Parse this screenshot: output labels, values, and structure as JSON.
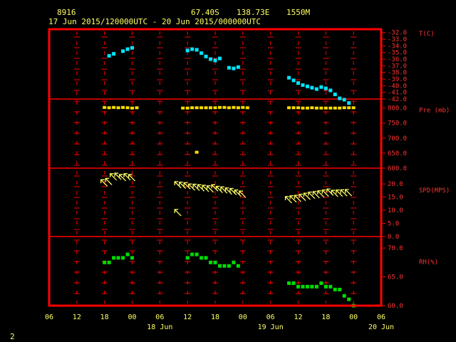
{
  "header": {
    "station": "8916",
    "lat": "67.40S",
    "lon": "138.73E",
    "elev": "1550M",
    "period": "17 Jun 2015/120000UTC - 20 Jun 2015/000000UTC"
  },
  "footer": {
    "page_number": "2"
  },
  "colors": {
    "frame": "#ff0000",
    "text": "#ffff66",
    "temp": "#00e5ff",
    "pres": "#ffdd00",
    "wind": "#ffff66",
    "rh": "#00dd00"
  },
  "chart_data": [
    {
      "type": "scatter",
      "name": "temperature",
      "ylabel": "T(C)",
      "ylim": [
        -42,
        -31.5
      ],
      "yticks": [
        "-32.0",
        "-33.0",
        "-34.0",
        "-35.0",
        "-36.0",
        "-37.0",
        "-38.0",
        "-39.0",
        "-40.0",
        "-41.0",
        "-42.0"
      ],
      "x_hours": [
        13,
        14,
        16,
        17,
        18,
        30,
        31,
        32,
        33,
        34,
        35,
        36,
        37,
        39,
        40,
        41,
        52,
        53,
        54,
        55,
        56,
        57,
        58,
        59,
        60,
        61,
        62,
        63,
        64,
        65
      ],
      "y": [
        -35.5,
        -35.2,
        -34.8,
        -34.5,
        -34.3,
        -34.7,
        -34.5,
        -34.6,
        -35.1,
        -35.6,
        -36.0,
        -36.2,
        -35.9,
        -37.3,
        -37.4,
        -37.2,
        -38.8,
        -39.2,
        -39.6,
        -39.9,
        -40.1,
        -40.3,
        -40.5,
        -40.2,
        -40.4,
        -40.7,
        -41.3,
        -41.9,
        -42.1,
        -42.6
      ],
      "x_hours_fixed": true
    },
    {
      "type": "scatter",
      "name": "pressure",
      "ylabel": "Pre (mb)",
      "ylim": [
        600,
        830
      ],
      "yticks": [
        "800.0",
        "750.0",
        "700.0",
        "650.0",
        "600.0"
      ],
      "x_hours": [
        12,
        13,
        14,
        15,
        16,
        17,
        18,
        19,
        29,
        30,
        31,
        32,
        33,
        34,
        35,
        36,
        37,
        38,
        39,
        40,
        41,
        42,
        43,
        52,
        53,
        54,
        55,
        56,
        57,
        58,
        59,
        60,
        61,
        62,
        63,
        64,
        65,
        66,
        32
      ],
      "y": [
        802,
        801,
        802,
        801,
        802,
        801,
        800,
        801,
        800,
        800,
        801,
        801,
        801,
        801,
        801,
        801,
        802,
        802,
        801,
        802,
        801,
        802,
        801,
        801,
        801,
        801,
        800,
        800,
        801,
        800,
        800,
        800,
        800,
        800,
        800,
        801,
        801,
        801,
        653
      ]
    },
    {
      "type": "wind_barbs",
      "name": "wind",
      "ylabel": "SPD(MPS)",
      "ylim": [
        0,
        26
      ],
      "yticks": [
        "20.0",
        "15.0",
        "10.0",
        "5.0",
        "0.0"
      ],
      "x_hours": [
        12,
        13,
        14,
        15,
        16,
        17,
        18,
        28,
        29,
        30,
        31,
        32,
        33,
        34,
        35,
        36,
        37,
        38,
        39,
        40,
        41,
        42,
        52,
        53,
        54,
        55,
        56,
        57,
        58,
        59,
        60,
        61,
        62,
        63,
        64,
        65
      ],
      "speed": [
        20.5,
        21.0,
        22.8,
        23.0,
        22.5,
        22.8,
        22.5,
        19.8,
        19.6,
        19.4,
        18.9,
        18.8,
        18.6,
        18.4,
        18.2,
        18.6,
        18.0,
        17.8,
        17.4,
        17.2,
        16.6,
        16.2,
        14.1,
        14.4,
        14.6,
        15.0,
        15.4,
        15.8,
        16.0,
        16.3,
        16.6,
        17.0,
        16.5,
        16.6,
        16.7,
        16.8
      ],
      "outlier": {
        "x_hours": 28,
        "speed": 9.2
      }
    },
    {
      "type": "scatter",
      "name": "relative_humidity",
      "ylabel": "RH(%)",
      "ylim": [
        60,
        72
      ],
      "yticks": [
        "70.0",
        "65.0",
        "60.0"
      ],
      "x_hours": [
        12,
        13,
        14,
        15,
        16,
        17,
        18,
        30,
        31,
        32,
        33,
        34,
        35,
        36,
        37,
        38,
        39,
        40,
        41,
        52,
        53,
        54,
        55,
        56,
        57,
        58,
        59,
        60,
        61,
        62,
        63,
        64,
        65,
        66
      ],
      "y": [
        67.5,
        67.5,
        68.3,
        68.3,
        68.3,
        68.9,
        68.3,
        68.3,
        68.9,
        68.9,
        68.3,
        68.3,
        67.5,
        67.5,
        66.9,
        66.9,
        66.9,
        67.5,
        66.9,
        63.9,
        63.9,
        63.3,
        63.3,
        63.3,
        63.3,
        63.3,
        63.9,
        63.3,
        63.3,
        62.8,
        62.8,
        61.7,
        61.1,
        60.0
      ]
    }
  ],
  "x_axis": {
    "ticks": [
      "06",
      "12",
      "18",
      "00",
      "06",
      "12",
      "18",
      "00",
      "06",
      "12",
      "18",
      "00",
      "06"
    ],
    "days": [
      "18 Jun",
      "19 Jun",
      "20 Jun"
    ]
  },
  "panel_labels": [
    "T(C)",
    "Pre (mb)",
    "SPD(MPS)",
    "RH(%)"
  ]
}
